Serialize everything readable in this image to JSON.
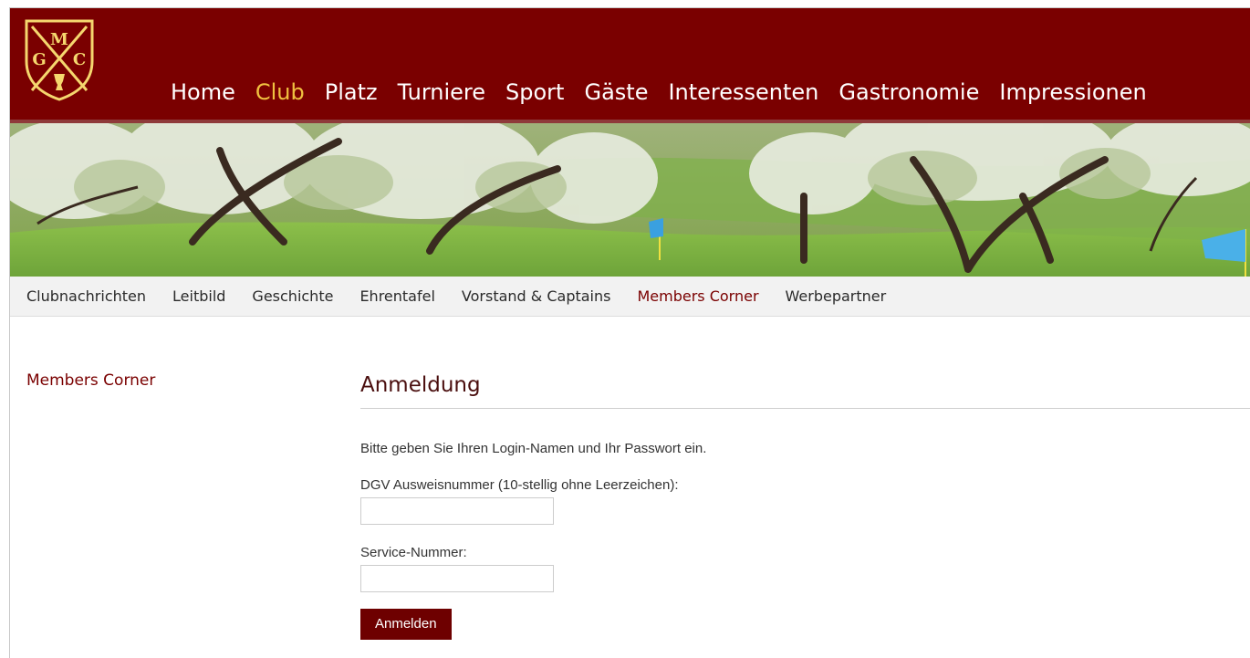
{
  "logo": {
    "letters": [
      "M",
      "G",
      "C"
    ],
    "name": "club-crest"
  },
  "main_nav": {
    "items": [
      "Home",
      "Club",
      "Platz",
      "Turniere",
      "Sport",
      "Gäste",
      "Interessenten",
      "Gastronomie",
      "Impressionen"
    ],
    "active_index": 1
  },
  "sub_nav": {
    "items": [
      "Clubnachrichten",
      "Leitbild",
      "Geschichte",
      "Ehrentafel",
      "Vorstand & Captains",
      "Members Corner",
      "Werbepartner"
    ],
    "active_index": 5
  },
  "sidebar": {
    "title": "Members Corner"
  },
  "login": {
    "title": "Anmeldung",
    "intro": "Bitte geben Sie Ihren Login-Namen und Ihr Passwort ein.",
    "field1_label": "DGV Ausweisnummer (10-stellig ohne Leerzeichen):",
    "field1_value": "",
    "field2_label": "Service-Nummer:",
    "field2_value": "",
    "submit_label": "Anmelden"
  },
  "colors": {
    "brand": "#7a0000",
    "active_nav": "#f0c040",
    "crest": "#f5d76e"
  }
}
